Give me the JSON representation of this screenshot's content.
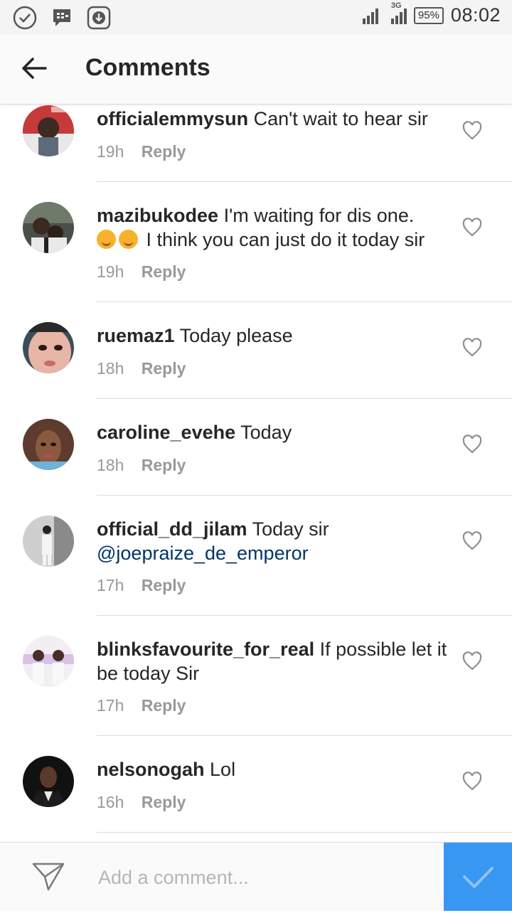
{
  "status_bar": {
    "time": "08:02",
    "battery": "95%",
    "network": "3G",
    "left_icons": [
      "check-circle-icon",
      "bbm-icon",
      "download-icon"
    ]
  },
  "header": {
    "title": "Comments",
    "back_icon": "arrow-left-icon"
  },
  "comments": [
    {
      "username": "officialemmysun",
      "text": "Can't wait to hear sir",
      "time": "19h",
      "reply": "Reply"
    },
    {
      "username": "mazibukodee",
      "text": "I'm waiting for dis one.",
      "text2": "I think you can just do it today sir",
      "emojis": 2,
      "time": "19h",
      "reply": "Reply"
    },
    {
      "username": "ruemaz1",
      "text": "Today please",
      "time": "18h",
      "reply": "Reply"
    },
    {
      "username": "caroline_evehe",
      "text": "Today",
      "time": "18h",
      "reply": "Reply"
    },
    {
      "username": "official_dd_jilam",
      "text": "Today sir",
      "mention": "@joepraize_de_emperor",
      "time": "17h",
      "reply": "Reply"
    },
    {
      "username": "blinksfavourite_for_real",
      "text": "If possible let it be today Sir",
      "time": "17h",
      "reply": "Reply"
    },
    {
      "username": "nelsonogah",
      "text": "Lol",
      "time": "16h",
      "reply": "Reply"
    }
  ],
  "composer": {
    "placeholder": "Add a comment...",
    "value": ""
  },
  "colors": {
    "accent": "#3897f0",
    "mention": "#003569",
    "meta": "#999999"
  }
}
